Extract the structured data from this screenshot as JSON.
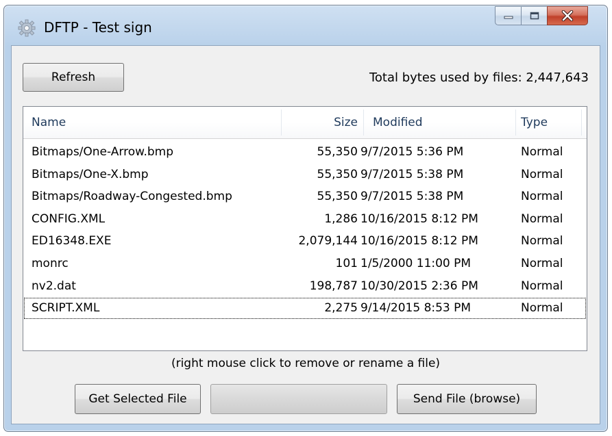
{
  "window": {
    "title": "DFTP - Test sign",
    "icon": "gear-icon"
  },
  "toolbar": {
    "refresh_label": "Refresh",
    "total_label": "Total bytes used by files: 2,447,643"
  },
  "file_list": {
    "columns": {
      "name": "Name",
      "size": "Size",
      "modified": "Modified",
      "type": "Type"
    },
    "rows": [
      {
        "name": "Bitmaps/One-Arrow.bmp",
        "size": "55,350",
        "modified": "9/7/2015 5:36 PM",
        "type": "Normal"
      },
      {
        "name": "Bitmaps/One-X.bmp",
        "size": "55,350",
        "modified": "9/7/2015 5:38 PM",
        "type": "Normal"
      },
      {
        "name": "Bitmaps/Roadway-Congested.bmp",
        "size": "55,350",
        "modified": "9/7/2015 5:38 PM",
        "type": "Normal"
      },
      {
        "name": "CONFIG.XML",
        "size": "1,286",
        "modified": "10/16/2015 8:12 PM",
        "type": "Normal"
      },
      {
        "name": "ED16348.EXE",
        "size": "2,079,144",
        "modified": "10/16/2015 8:12 PM",
        "type": "Normal"
      },
      {
        "name": "monrc",
        "size": "101",
        "modified": "1/5/2000 11:00 PM",
        "type": "Normal"
      },
      {
        "name": "nv2.dat",
        "size": "198,787",
        "modified": "10/30/2015 2:36 PM",
        "type": "Normal"
      },
      {
        "name": "SCRIPT.XML",
        "size": "2,275",
        "modified": "9/14/2015 8:53 PM",
        "type": "Normal"
      }
    ],
    "selected_index": 7
  },
  "hint": "(right mouse click to remove or rename a file)",
  "footer": {
    "get_label": "Get Selected File",
    "send_label": "Send File (browse)",
    "progress_value": 0
  }
}
